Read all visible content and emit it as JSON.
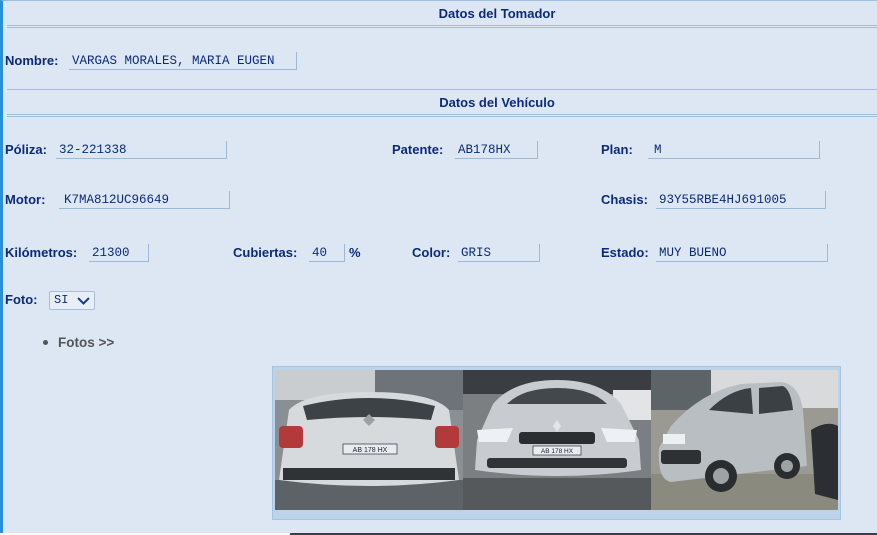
{
  "sections": {
    "tomador_title": "Datos del Tomador",
    "vehiculo_title": "Datos del Vehículo"
  },
  "tomador": {
    "nombre_label": "Nombre:",
    "nombre_value": "VARGAS MORALES, MARIA EUGEN"
  },
  "vehiculo": {
    "poliza_label": "Póliza:",
    "poliza_value": "32-221338",
    "patente_label": "Patente:",
    "patente_value": "AB178HX",
    "plan_label": "Plan:",
    "plan_value": "M",
    "motor_label": "Motor:",
    "motor_value": "K7MA812UC96649",
    "chasis_label": "Chasis:",
    "chasis_value": "93Y55RBE4HJ691005",
    "km_label": "Kilómetros:",
    "km_value": "21300",
    "cubiertas_label": "Cubiertas:",
    "cubiertas_value": "40",
    "cubiertas_unit": "%",
    "color_label": "Color:",
    "color_value": "GRIS",
    "estado_label": "Estado:",
    "estado_value": "MUY BUENO",
    "foto_label": "Foto:",
    "foto_value": "SI"
  },
  "fotos_link": "Fotos >>",
  "gallery": {
    "photos": [
      "car-rear-photo",
      "car-front-photo",
      "car-side-photo"
    ],
    "plate_text": "AB 178 HX"
  },
  "colors": {
    "label": "#0d2a7a",
    "background": "#dce7f3",
    "accent": "#2a8fd6"
  }
}
